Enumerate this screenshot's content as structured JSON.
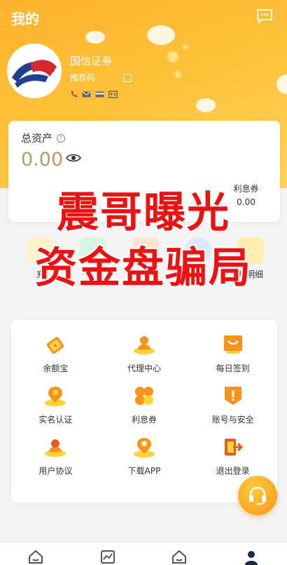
{
  "header": {
    "title": "我的"
  },
  "profile": {
    "broker_name": "国信证券",
    "referral_label": "推荐码",
    "contact_icons": [
      "phone-icon",
      "mail-icon",
      "card-icon",
      "id-card-icon"
    ]
  },
  "assets": {
    "label": "总资产",
    "value": "0.00",
    "stats": [
      {
        "label": "",
        "value": ""
      },
      {
        "label": "",
        "value": ""
      },
      {
        "label": "",
        "value": ""
      },
      {
        "label": "利息券",
        "value": "0.00"
      }
    ]
  },
  "quick_actions": [
    {
      "label": "充",
      "icon": "recharge-icon"
    },
    {
      "label": "",
      "icon": "withdraw-icon"
    },
    {
      "label": "",
      "icon": "transfer-icon"
    },
    {
      "label": "",
      "icon": "globe-icon"
    },
    {
      "label": "月明细",
      "icon": "detail-icon"
    }
  ],
  "watermark": {
    "line1": "震哥曝光",
    "line2": "资金盘骗局"
  },
  "menu": [
    {
      "label": "余额宝",
      "icon": "money-bag-icon"
    },
    {
      "label": "代理中心",
      "icon": "agent-icon"
    },
    {
      "label": "每日签到",
      "icon": "checkin-icon"
    },
    {
      "label": "实名认证",
      "icon": "location-verify-icon"
    },
    {
      "label": "利息券",
      "icon": "coupon-icon"
    },
    {
      "label": "账号与安全",
      "icon": "shield-alert-icon"
    },
    {
      "label": "用户协议",
      "icon": "agreement-icon"
    },
    {
      "label": "下载APP",
      "icon": "download-pin-icon"
    },
    {
      "label": "退出登录",
      "icon": "logout-icon"
    }
  ],
  "tabbar": [
    "home-icon",
    "chart-icon",
    "home-alt-icon",
    "user-icon"
  ],
  "colors": {
    "primary": "#fdb22d",
    "accent_orange": "#f7921c",
    "watermark": "#ee1111",
    "asset_value": "#b89a6a"
  }
}
